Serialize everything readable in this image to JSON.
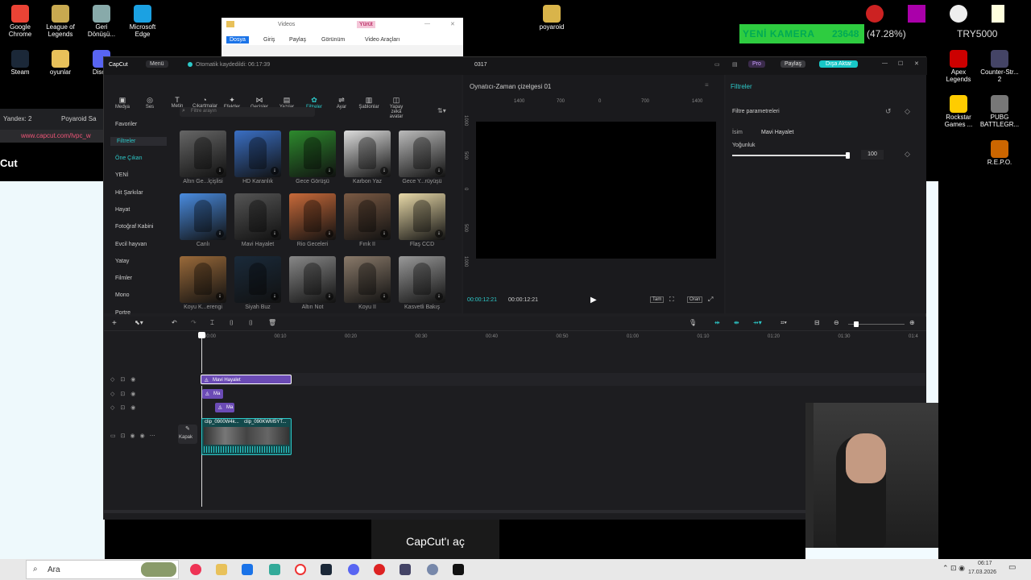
{
  "desktop": {
    "icons_left": [
      {
        "label": "Google Chrome",
        "color": "#ea4335"
      },
      {
        "label": "League of Legends",
        "color": "#c8a950"
      },
      {
        "label": "Geri Dönüşü...",
        "color": "#8aa"
      },
      {
        "label": "Microsoft Edge",
        "color": "#1ba1e2"
      },
      {
        "label": "Steam",
        "color": "#1b2838"
      },
      {
        "label": "oyunlar",
        "color": "#e8c15a"
      },
      {
        "label": "Disc...",
        "color": "#5865f2"
      }
    ],
    "polaroid_label": "poyaroid",
    "icons_right": [
      {
        "label": "Apex Legends",
        "color": "#c00"
      },
      {
        "label": "Counter-Str... 2",
        "color": "#446"
      },
      {
        "label": "Rockstar Games ...",
        "color": "#fc0"
      },
      {
        "label": "PUBG BATTLEGR...",
        "color": "#777"
      },
      {
        "label": "R.E.P.O.",
        "color": "#c60"
      }
    ],
    "overlay_camera": "YENİ KAMERA",
    "overlay_count": "23648",
    "overlay_percent": "(47.28%)",
    "overlay_goal": "TRY5000",
    "browser_tab1": "Yandex: 2",
    "browser_tab2": "Poyaroid Sa",
    "browser_url": "www.capcut.com/lvpc_w",
    "browser_heading": "Cut"
  },
  "explorer": {
    "title": "Videos",
    "manage": "Yürüt",
    "tabs": [
      "Dosya",
      "Giriş",
      "Paylaş",
      "Görünüm",
      "Video Araçları"
    ]
  },
  "capcut": {
    "app_name": "CapCut",
    "menu": "Menü",
    "autosave": "Otomatik kaydedildi: 06:17:39",
    "project": "0317",
    "pro": "Pro",
    "share": "Paylaş",
    "export": "Dışa Aktar",
    "toolbar": [
      "Medya",
      "Ses",
      "Metin",
      "Çıkartmalar",
      "Efektler",
      "Geçişler",
      "Yazılar",
      "Filtreler",
      "Ayar",
      "Şablonlar",
      "Yapay zekâ avatar"
    ],
    "toolbar_glyphs": [
      "▣",
      "◎",
      "T",
      "◔",
      "✦",
      "⋈",
      "▤",
      "✿",
      "⇌",
      "▥",
      "◫"
    ],
    "categories": [
      "Favoriler",
      "Filtreler",
      "Öne Çıkan",
      "YENİ",
      "Hit Şarkılar",
      "Hayat",
      "Fotoğraf Kabini",
      "Evcil hayvan",
      "Yatay",
      "Filmler",
      "Mono",
      "Portre"
    ],
    "search_placeholder": "Filtre arayın",
    "filters": [
      {
        "name": "Altın Ge...lçişlisi",
        "color": "#666"
      },
      {
        "name": "HD Karanlık",
        "color": "#3a6fc4"
      },
      {
        "name": "Gece Görüşü",
        "color": "#2d8a2d"
      },
      {
        "name": "Karbon Yaz",
        "color": "#ddd"
      },
      {
        "name": "Gece Y...rüyüşü",
        "color": "#bbb"
      },
      {
        "name": "Canlı",
        "color": "#4a8ce0"
      },
      {
        "name": "Mavi Hayalet",
        "color": "#555"
      },
      {
        "name": "Rio Geceleri",
        "color": "#c86a3a"
      },
      {
        "name": "Fırık II",
        "color": "#7a5a44"
      },
      {
        "name": "Flaş CCD",
        "color": "#e8d9a8"
      },
      {
        "name": "Koyu K...erengi",
        "color": "#9a6a3a"
      },
      {
        "name": "Siyah Buz",
        "color": "#1a2a3a"
      },
      {
        "name": "Altın Not",
        "color": "#888"
      },
      {
        "name": "Koyu II",
        "color": "#8a7a6a"
      },
      {
        "name": "Kasvetli Bakış",
        "color": "#999"
      }
    ],
    "player_title": "Oynatıcı-Zaman çizelgesi 01",
    "ruler_h": [
      "1400",
      "700",
      "0",
      "700",
      "1400"
    ],
    "ruler_v": [
      "1000",
      "500",
      "0",
      "500",
      "1000"
    ],
    "time_current": "00:00:12:21",
    "time_total": "00:00:12:21",
    "player_btns": [
      "Tam",
      "Oran"
    ],
    "right_title": "Filtreler",
    "params_title": "Filtre parametreleri",
    "name_label": "İsim",
    "name_value": "Mavi Hayalet",
    "intensity_label": "Yoğunluk",
    "intensity_value": "100",
    "intensity": 100,
    "timeline_marks": [
      "00:00",
      "00:10",
      "00:20",
      "00:30",
      "00:40",
      "00:50",
      "01:00",
      "01:10",
      "01:20",
      "01:30",
      "01:4"
    ],
    "clip_filter": "Mavi Hayalet",
    "clip_small1": "Ma",
    "clip_small2": "Ma",
    "clip_video1": "clip_0900W4k...",
    "clip_video2": "clip_090KWM5YT...",
    "cover": "Kapak",
    "tooltip": "CapCut'ı aç"
  },
  "taskbar": {
    "search": "Ara",
    "time": "06:17",
    "date": "17.03.2026"
  }
}
